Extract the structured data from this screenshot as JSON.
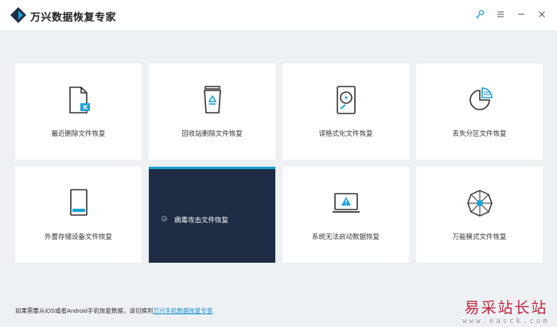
{
  "app": {
    "title": "万兴数据恢复专家",
    "accent_color": "#1ba1d6",
    "active_card_color": "#1e2d45"
  },
  "window_controls": [
    {
      "name": "key-icon"
    },
    {
      "name": "menu-icon"
    },
    {
      "name": "minimize-icon"
    },
    {
      "name": "close-icon"
    }
  ],
  "cards": [
    {
      "label": "最近删除文件恢复",
      "icon": "deleted-file-icon"
    },
    {
      "label": "回收站删除文件恢复",
      "icon": "recycle-bin-icon"
    },
    {
      "label": "误格式化文件恢复",
      "icon": "hard-drive-icon"
    },
    {
      "label": "丢失分区文件恢复",
      "icon": "partition-icon"
    },
    {
      "label": "外置存储设备文件恢复",
      "icon": "external-device-icon"
    },
    {
      "label": "病毒攻击文件恢复",
      "icon": "virus-icon",
      "active": true
    },
    {
      "label": "系统无法启动数据恢复",
      "icon": "system-crash-icon"
    },
    {
      "label": "万能模式文件恢复",
      "icon": "all-round-icon"
    }
  ],
  "footer": {
    "text": "如果需要从iOS或者Android手机恢复数据，请切换到",
    "link": "万兴手机数据恢复专家"
  },
  "watermark": {
    "main": "易采站长站",
    "sub": "www.easck.com"
  }
}
